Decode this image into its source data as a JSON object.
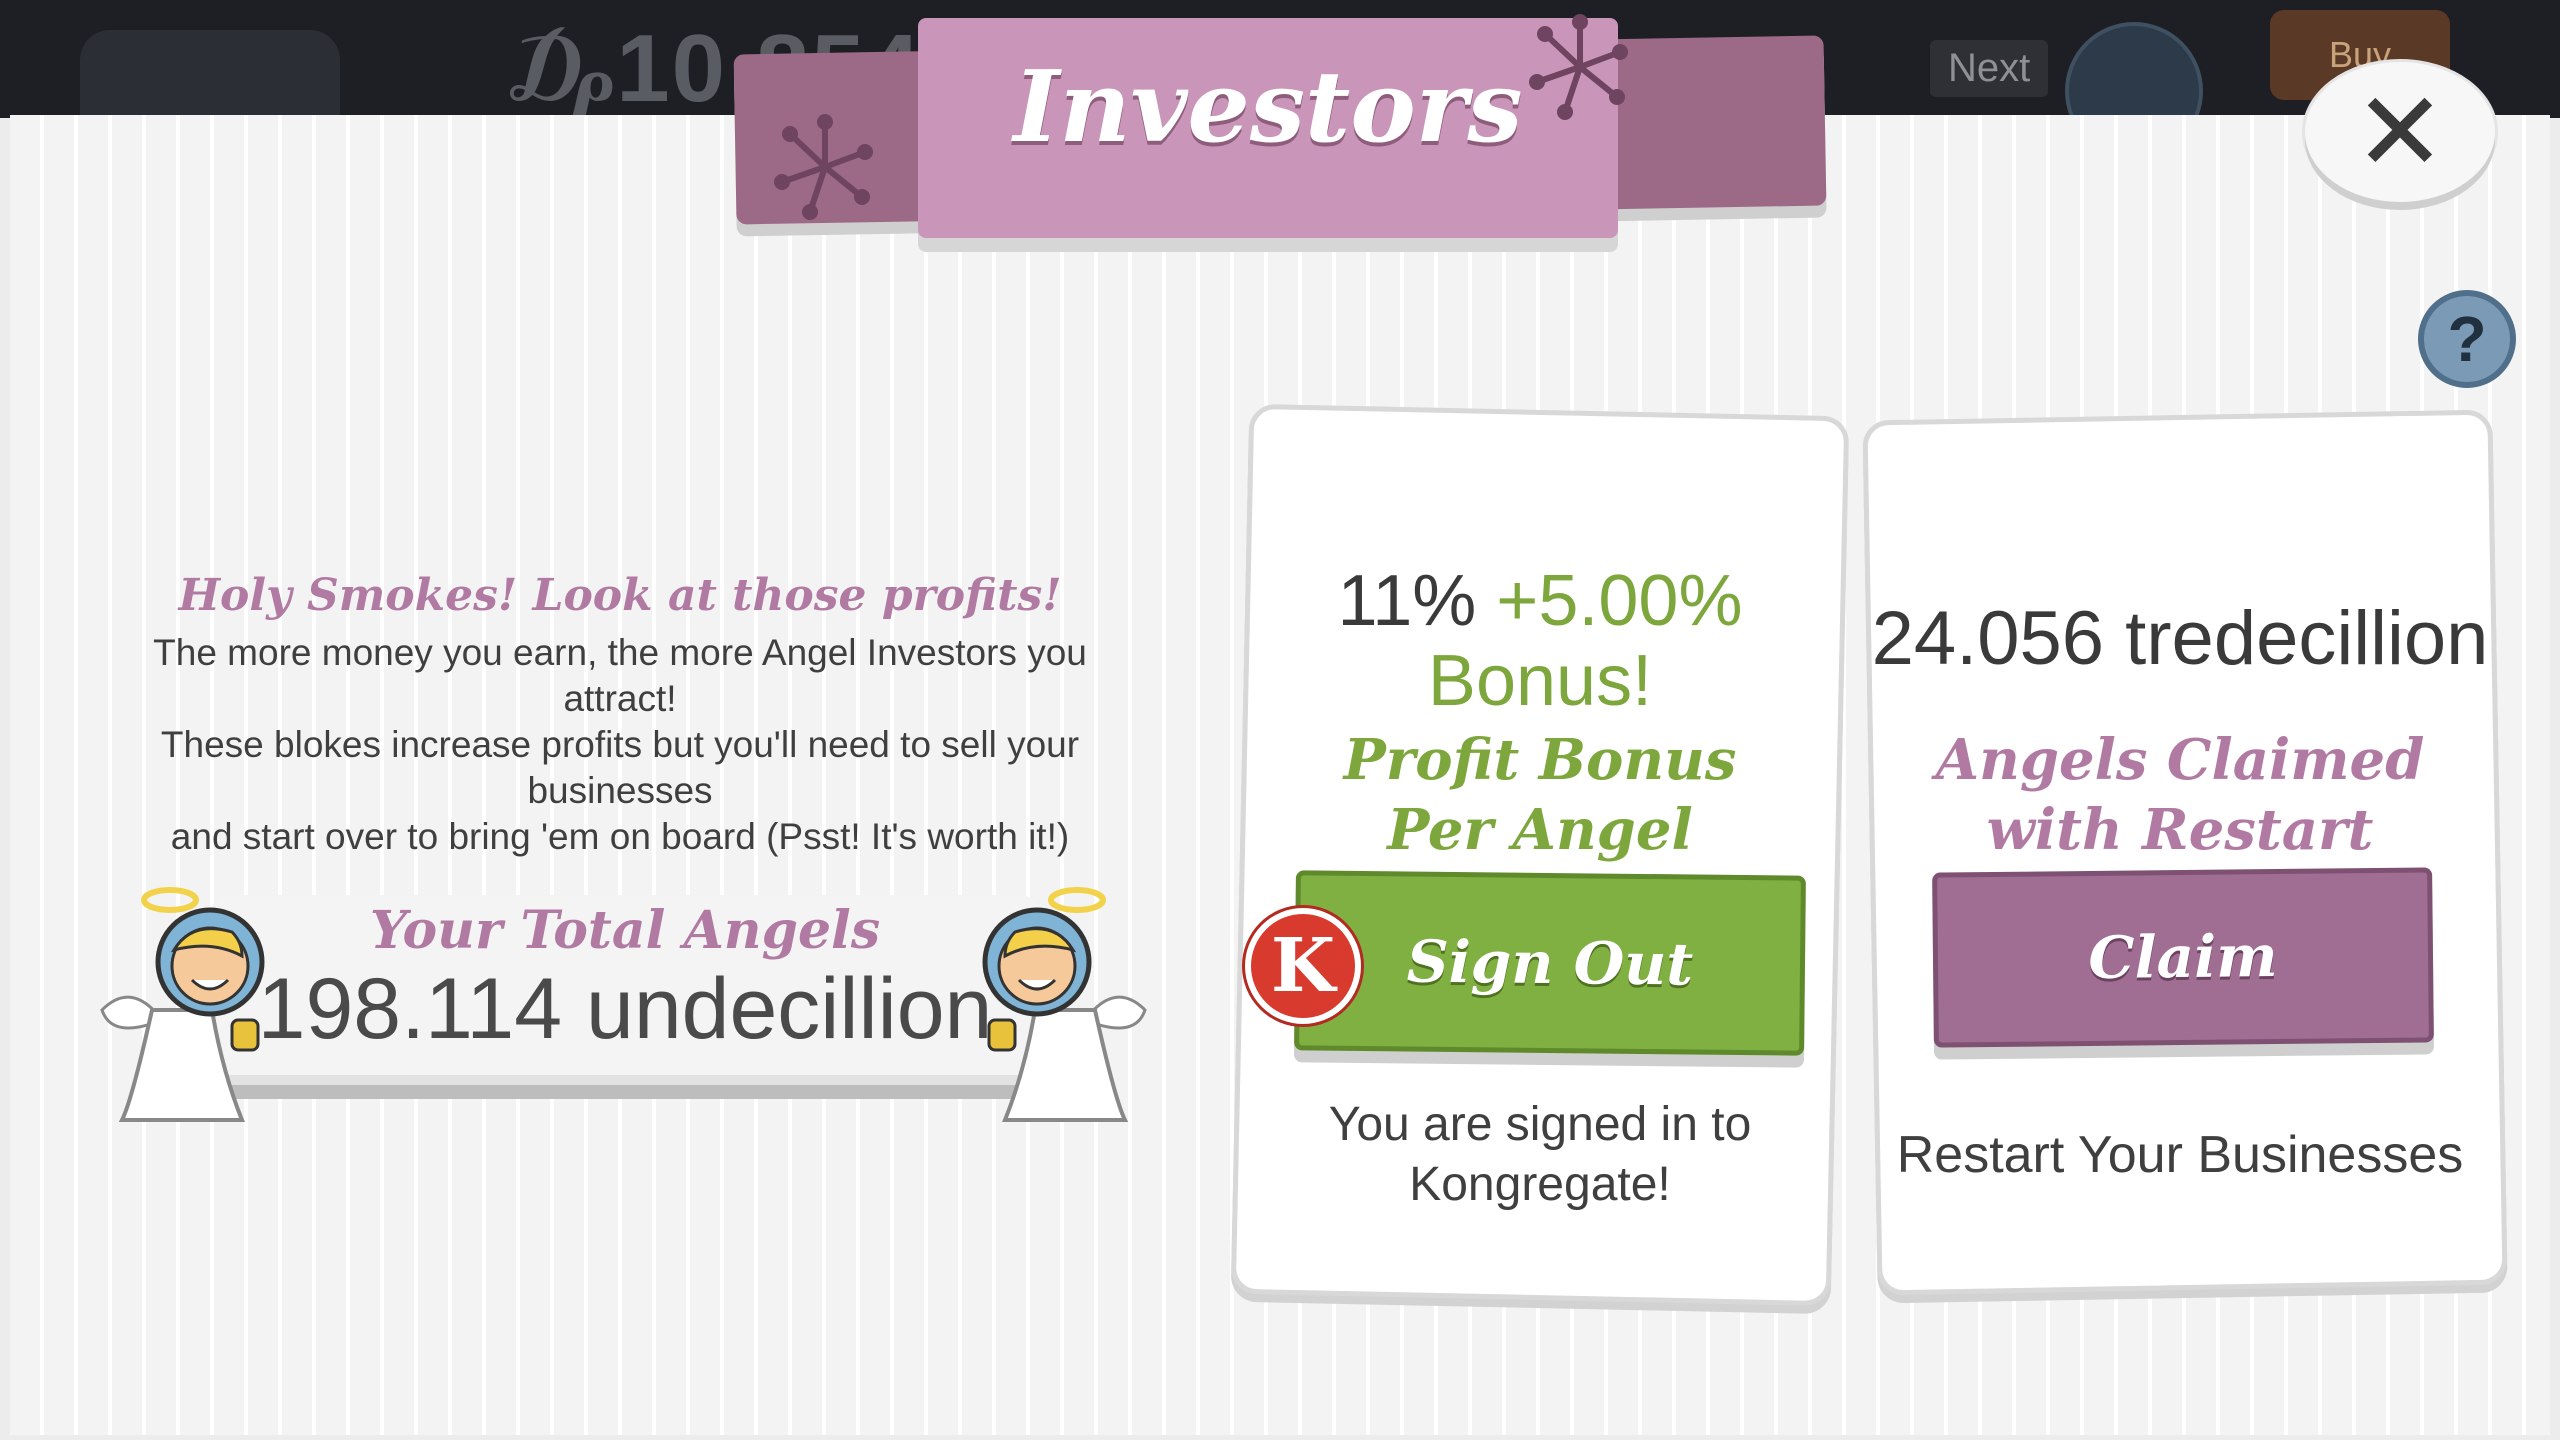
{
  "hud": {
    "money": "₯10 854",
    "next_label": "Next",
    "buy_label": "Buy"
  },
  "modal": {
    "title": "Investors",
    "close_icon": "close-x-icon",
    "help_icon": "question-mark-icon",
    "help_label": "?"
  },
  "intro": {
    "heading": "Holy Smokes! Look at those profits!",
    "lines": [
      "The more money you earn, the more Angel Investors you attract!",
      "These blokes increase profits but you'll need to sell your businesses",
      "and start over to bring 'em on board (Psst! It's worth it!)"
    ]
  },
  "angels": {
    "label": "Your Total Angels",
    "value": "198.114 undecillion"
  },
  "bonus_card": {
    "percent": "11%",
    "plus_percent": "+5.00%",
    "bonus_word": "Bonus!",
    "desc_line1": "Profit Bonus",
    "desc_line2": "Per Angel",
    "button_label": "Sign Out",
    "badge_letter": "K",
    "status_line1": "You are signed in to",
    "status_line2": "Kongregate!"
  },
  "claim_card": {
    "amount": "24.056 tredecillion",
    "desc_line1": "Angels Claimed",
    "desc_line2": "with Restart",
    "button_label": "Claim",
    "footer": "Restart Your Businesses"
  },
  "colors": {
    "accent_purple": "#b17aa2",
    "accent_green": "#7da73c",
    "button_green": "#7fb041",
    "button_purple": "#a16e93",
    "kongregate_red": "#d83a2e"
  }
}
